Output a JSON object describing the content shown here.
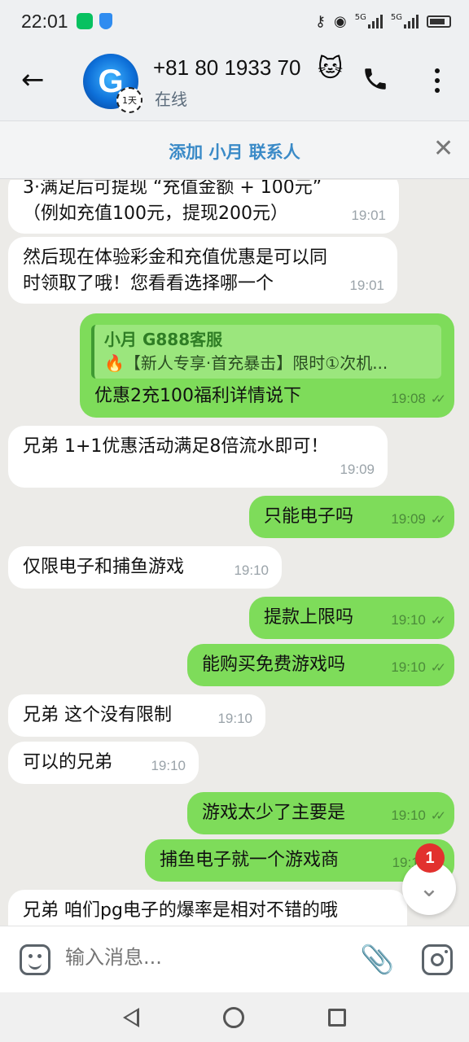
{
  "status_bar": {
    "time": "22:01",
    "network_1": "5G",
    "network_2": "5G"
  },
  "header": {
    "contact_name": "+81 80 1933 70",
    "contact_status": "在线",
    "avatar_letter": "G",
    "timer_label": "1天"
  },
  "add_contact": {
    "label": "添加 小月 联系人"
  },
  "messages": [
    {
      "dir": "in",
      "text": "3·满足后可提现 “充值金额 + 100元”\n（例如充值100元，提现200元）",
      "time": "19:01"
    },
    {
      "dir": "in",
      "text": "然后现在体验彩金和充值优惠是可以同\n时领取了哦！您看看选择哪一个",
      "time": "19:01"
    },
    {
      "dir": "out",
      "reply_name": "小月 G888客服",
      "reply_text": "🔥【新人专享·首充暴击】限时①次机...",
      "text": "优惠2充100福利详情说下",
      "time": "19:08"
    },
    {
      "dir": "in",
      "text": "兄弟 1+1优惠活动满足8倍流水即可！",
      "time": "19:09"
    },
    {
      "dir": "out",
      "text": "只能电子吗",
      "time": "19:09"
    },
    {
      "dir": "in",
      "text": "仅限电子和捕鱼游戏",
      "time": "19:10"
    },
    {
      "dir": "out",
      "text": "提款上限吗",
      "time": "19:10"
    },
    {
      "dir": "out",
      "text": "能购买免费游戏吗",
      "time": "19:10"
    },
    {
      "dir": "in",
      "text": "兄弟 这个没有限制",
      "time": "19:10"
    },
    {
      "dir": "in",
      "text": "可以的兄弟",
      "time": "19:10"
    },
    {
      "dir": "out",
      "text": "游戏太少了主要是",
      "time": "19:10"
    },
    {
      "dir": "out",
      "text": "捕鱼电子就一个游戏商",
      "time": "19:11"
    },
    {
      "dir": "in",
      "text": "兄弟 咱们pg电子的爆率是相对不错的哦",
      "time": ""
    }
  ],
  "scroll": {
    "unread_count": "1"
  },
  "input": {
    "placeholder": "输入消息..."
  }
}
